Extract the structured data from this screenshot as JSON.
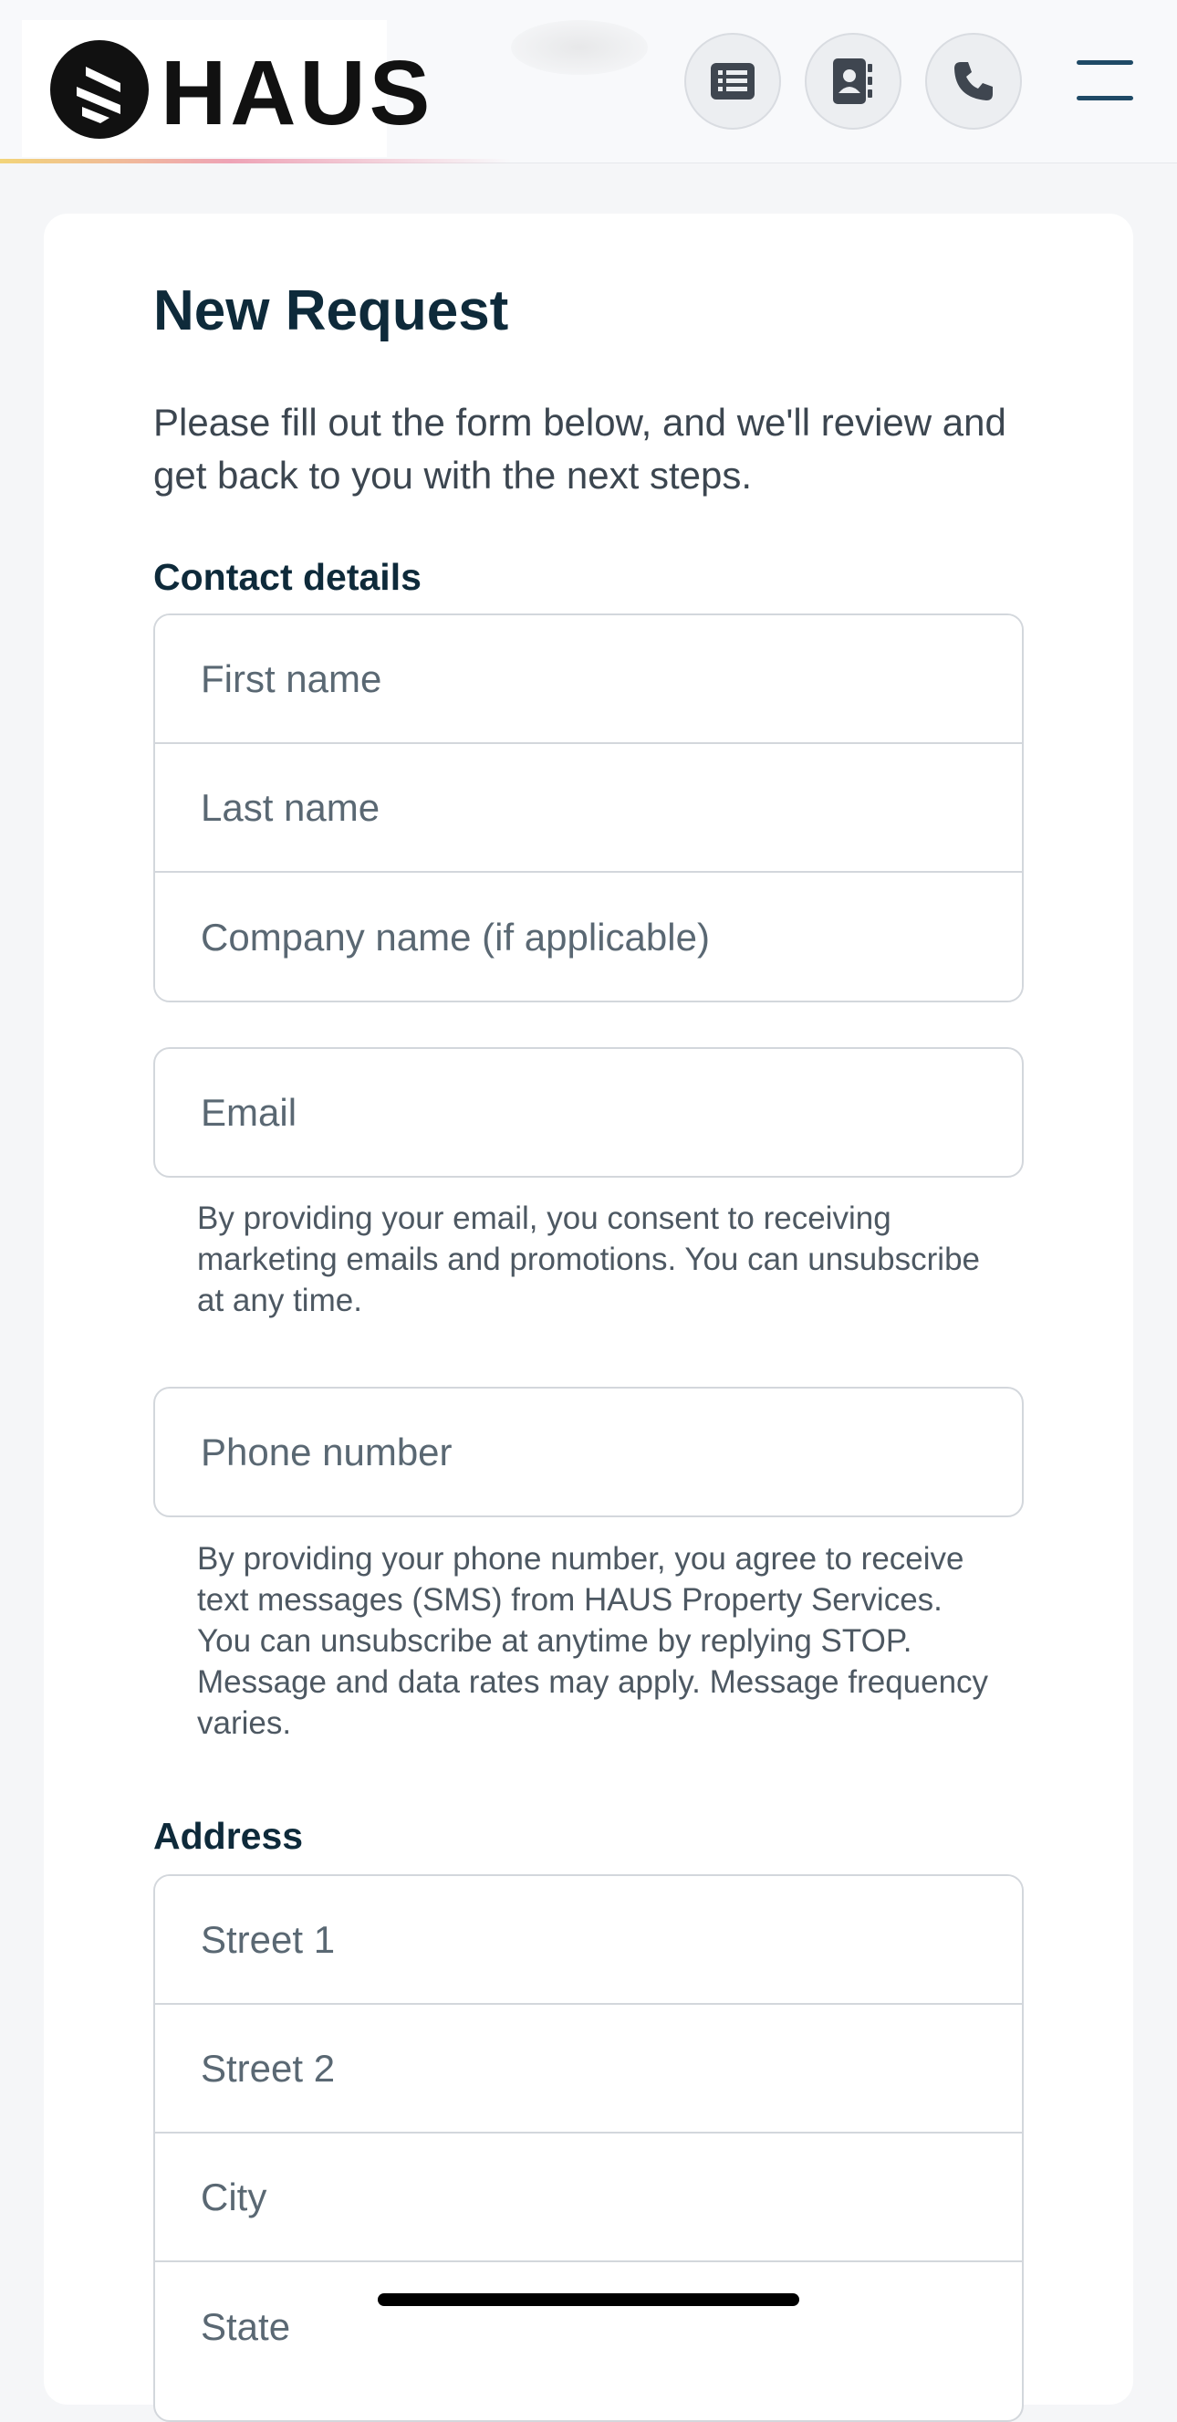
{
  "brand": {
    "name": "HAUS"
  },
  "header": {
    "buttons": [
      {
        "icon": "list-icon",
        "label": "Requests"
      },
      {
        "icon": "contact-book-icon",
        "label": "Contact"
      },
      {
        "icon": "phone-icon",
        "label": "Call"
      }
    ],
    "menu_icon": "hamburger-menu-icon"
  },
  "form": {
    "title": "New Request",
    "intro": "Please fill out the form below, and we'll review and get back to you with the next steps.",
    "contact": {
      "label": "Contact details",
      "first_name_placeholder": "First name",
      "last_name_placeholder": "Last name",
      "company_placeholder": "Company name (if applicable)",
      "email_placeholder": "Email",
      "email_help": "By providing your email, you consent to receiving marketing emails and promotions. You can unsubscribe at any time.",
      "phone_placeholder": "Phone number",
      "phone_help": "By providing your phone number, you agree to receive text messages (SMS) from HAUS Property Services. You can unsubscribe at anytime by replying STOP. Message and data rates may apply. Message frequency varies."
    },
    "address": {
      "label": "Address",
      "street1_placeholder": "Street 1",
      "street2_placeholder": "Street 2",
      "city_placeholder": "City",
      "state_placeholder": "State"
    }
  },
  "colors": {
    "heading": "#0e2a3a",
    "border": "#d3d7dc",
    "placeholder": "#5a6873",
    "menu": "#1f4a66"
  }
}
